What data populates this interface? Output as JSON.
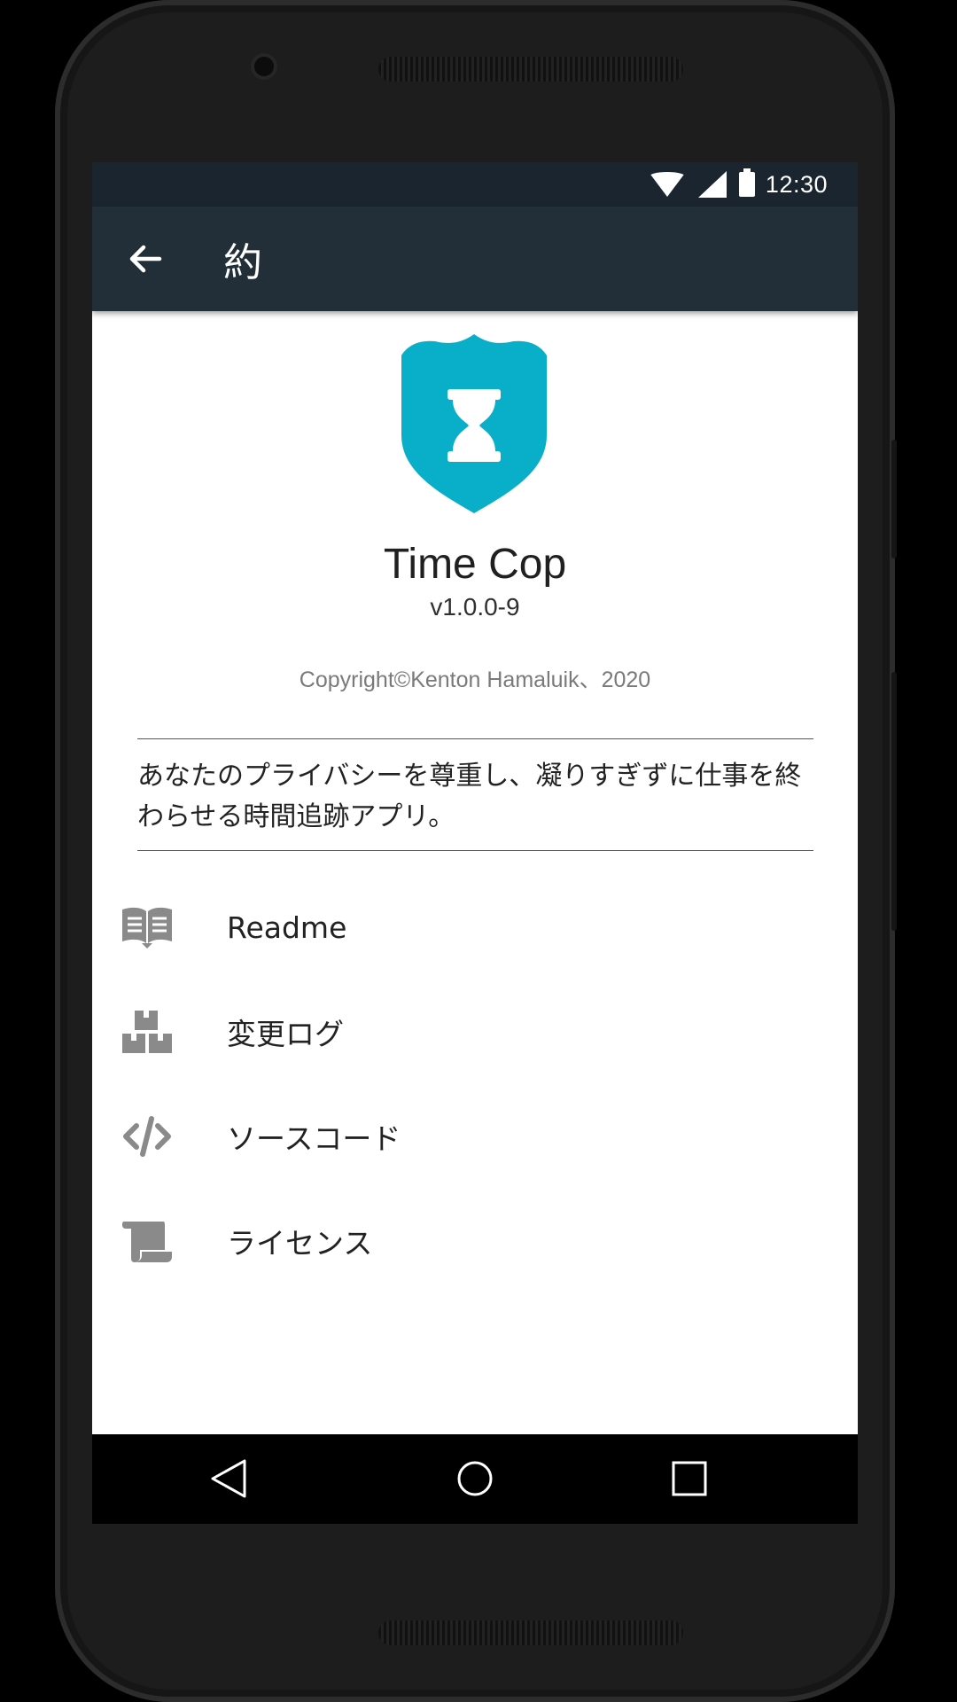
{
  "status_bar": {
    "time": "12:30"
  },
  "app_bar": {
    "title": "約"
  },
  "about": {
    "app_name": "Time Cop",
    "version": "v1.0.0-9",
    "copyright": "Copyright©Kenton Hamaluik、2020",
    "description": "あなたのプライバシーを尊重し、凝りすぎずに仕事を終わらせる時間追跡アプリ。"
  },
  "menu": {
    "items": [
      {
        "label": "Readme",
        "icon": "book-icon"
      },
      {
        "label": "変更ログ",
        "icon": "boxes-icon"
      },
      {
        "label": "ソースコード",
        "icon": "code-icon"
      },
      {
        "label": "ライセンス",
        "icon": "scroll-icon"
      }
    ]
  },
  "colors": {
    "accent": "#09AEC8",
    "app_bar": "#232F38",
    "status_bar": "#1B252F",
    "icon_gray": "#8A8A8A"
  }
}
